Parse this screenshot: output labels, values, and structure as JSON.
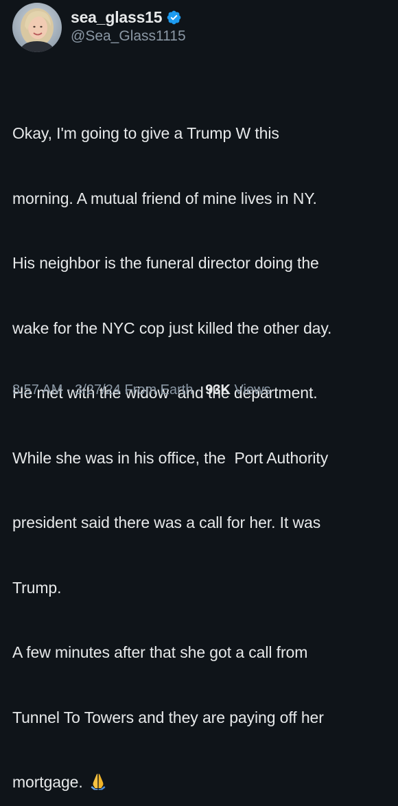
{
  "user": {
    "display_name": "sea_glass15",
    "handle": "@Sea_Glass1115",
    "verified_icon": "verified-badge-icon",
    "badge_color": "#1d9bf0"
  },
  "tweet": {
    "lines": [
      "Okay, I'm going to give a Trump W this",
      "morning. A mutual friend of mine lives in NY.",
      "His neighbor is the funeral director doing the",
      "wake for the NYC cop just killed the other day.",
      "He met with the widow  and the department.",
      "While she was in his office, the  Port Authority",
      "president said there was a call for her. It was",
      "Trump.",
      "A few minutes after that she got a call from",
      "Tunnel To Towers and they are paying off her",
      "mortgage. "
    ],
    "emoji_icon": "folded-hands-icon"
  },
  "meta": {
    "time": "8:57 AM",
    "separator": " · ",
    "date": "3/27/24",
    "source": " From Earth",
    "views_count": "93K",
    "views_label": " Views"
  },
  "colors": {
    "background": "#0f1419",
    "text": "#e7e9ea",
    "muted": "#8b98a5"
  }
}
